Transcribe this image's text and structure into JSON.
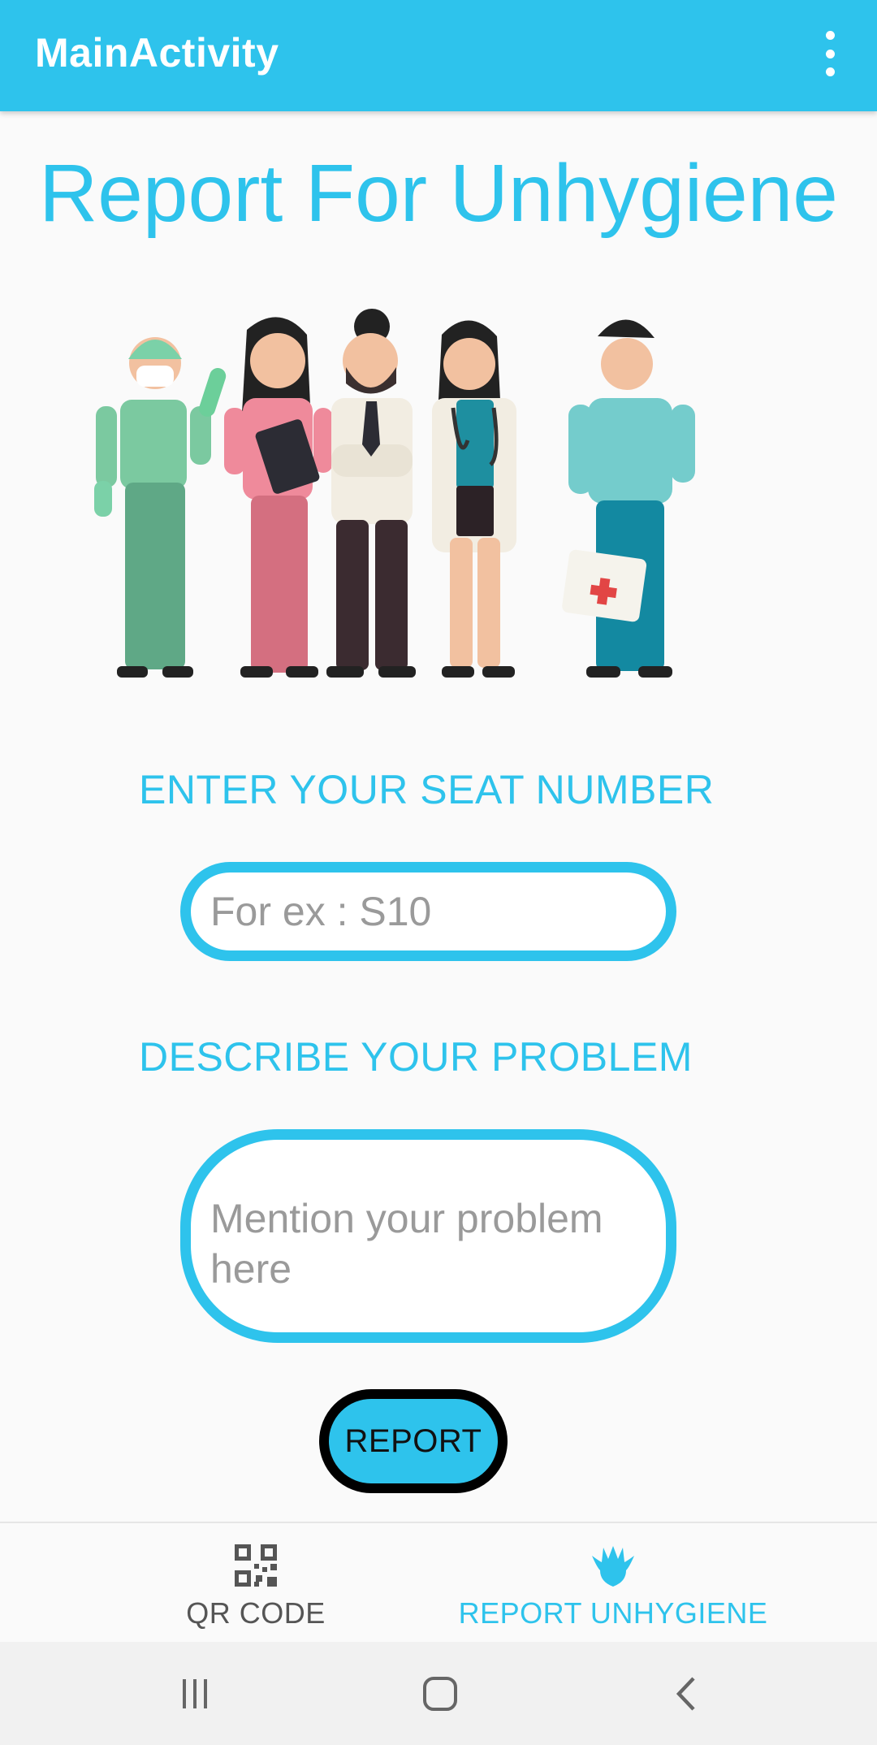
{
  "appbar": {
    "title": "MainActivity",
    "menu_icon": "more-vert-icon"
  },
  "page": {
    "heading": "Report For Unhygiene"
  },
  "form": {
    "seat_label": "ENTER YOUR SEAT NUMBER",
    "seat_placeholder": "For ex : S10",
    "problem_label": "DESCRIBE YOUR PROBLEM",
    "problem_placeholder": "Mention your problem here",
    "report_button": "REPORT"
  },
  "bottom_nav": {
    "items": [
      {
        "label": "QR CODE",
        "icon": "qr-code-icon",
        "selected": false
      },
      {
        "label": "REPORT UNHYGIENE",
        "icon": "report-unhygiene-icon",
        "selected": true
      }
    ]
  },
  "system_nav": {
    "recents_icon": "recents-icon",
    "home_icon": "home-icon",
    "back_icon": "back-icon"
  },
  "colors": {
    "accent": "#2ec3ec",
    "report_button_border": "#000000",
    "background": "#fafafa"
  }
}
